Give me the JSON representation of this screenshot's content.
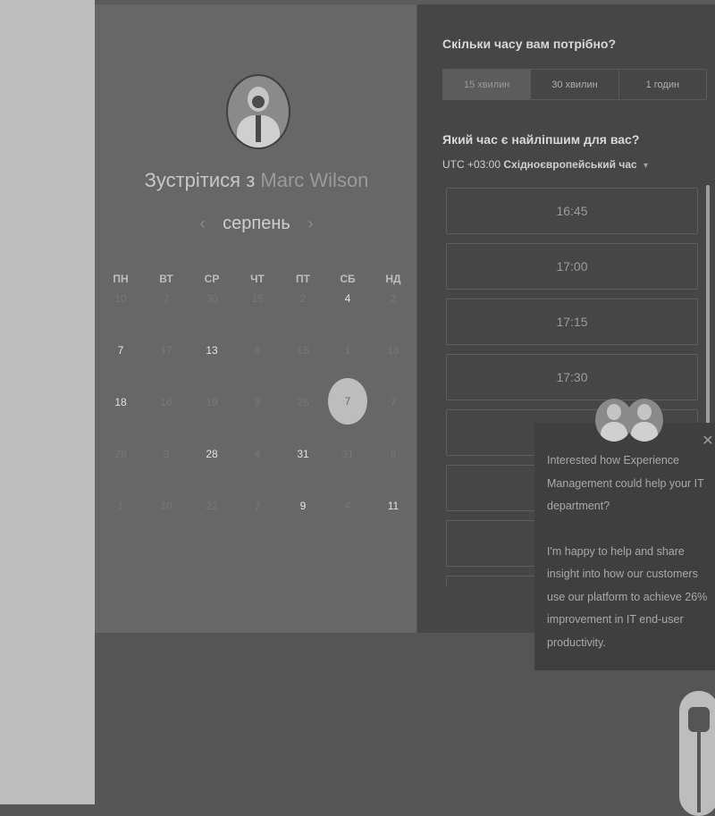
{
  "calendar": {
    "title_prefix": "Зустрітися з",
    "host_name": "Marc Wilson",
    "month": "серпень",
    "prev_icon": "chevron-left-icon",
    "next_icon": "chevron-right-icon",
    "weekdays": [
      "ПН",
      "ВТ",
      "СР",
      "ЧТ",
      "ПТ",
      "СБ",
      "НД"
    ],
    "weeks": [
      [
        {
          "d": "10",
          "a": false
        },
        {
          "d": "7",
          "a": false
        },
        {
          "d": "30",
          "a": false
        },
        {
          "d": "15",
          "a": false
        },
        {
          "d": "2",
          "a": false
        },
        {
          "d": "4",
          "a": true
        },
        {
          "d": "2",
          "a": false
        }
      ],
      [
        {
          "d": "7",
          "a": true
        },
        {
          "d": "17",
          "a": false
        },
        {
          "d": "13",
          "a": true
        },
        {
          "d": "4",
          "a": false
        },
        {
          "d": "18",
          "a": false
        },
        {
          "d": "1",
          "a": false
        },
        {
          "d": "18",
          "a": false
        }
      ],
      [
        {
          "d": "18",
          "a": true
        },
        {
          "d": "16",
          "a": false
        },
        {
          "d": "19",
          "a": false
        },
        {
          "d": "9",
          "a": false
        },
        {
          "d": "26",
          "a": false
        },
        {
          "d": "7",
          "a": true,
          "selected": true
        },
        {
          "d": "7",
          "a": false
        }
      ],
      [
        {
          "d": "28",
          "a": false
        },
        {
          "d": "3",
          "a": false
        },
        {
          "d": "28",
          "a": true
        },
        {
          "d": "4",
          "a": false
        },
        {
          "d": "31",
          "a": true
        },
        {
          "d": "31",
          "a": false
        },
        {
          "d": "8",
          "a": false
        }
      ],
      [
        {
          "d": "1",
          "a": false
        },
        {
          "d": "10",
          "a": false
        },
        {
          "d": "22",
          "a": false
        },
        {
          "d": "7",
          "a": false
        },
        {
          "d": "9",
          "a": true
        },
        {
          "d": "4",
          "a": false
        },
        {
          "d": "11",
          "a": true
        }
      ]
    ]
  },
  "booking": {
    "duration_question": "Скільки часу вам потрібно?",
    "durations": [
      "15 хвилин",
      "30 хвилин",
      "1 годин"
    ],
    "selected_duration_index": 0,
    "time_question": "Який час є найліпшим для вас?",
    "timezone_offset": "UTC +03:00",
    "timezone_name": "Східноєвропейський час",
    "timezone_caret_icon": "caret-down-icon",
    "time_slots": [
      "16:45",
      "17:00",
      "17:15",
      "17:30",
      "",
      "",
      "",
      ""
    ]
  },
  "chat": {
    "paragraph_1": "Interested how Experience Management could help your IT department?",
    "paragraph_2": "I'm happy to help and share insight into how our customers use our platform to achieve 26% improvement in IT end-user productivity.",
    "close_icon": "close-icon",
    "close_symbol": "✕"
  }
}
